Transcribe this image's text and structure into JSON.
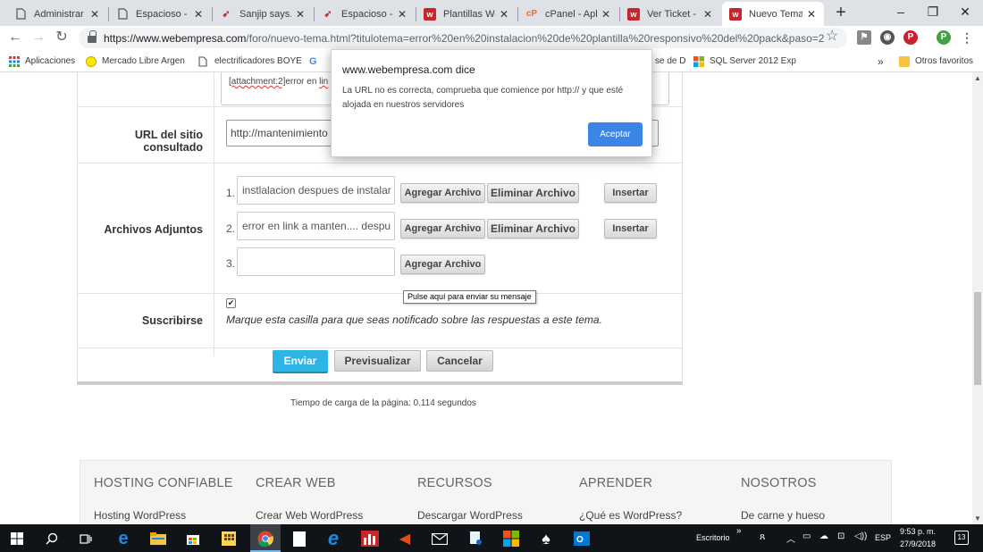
{
  "browser": {
    "tabs": [
      {
        "title": "Administrar te",
        "icon": "document-icon"
      },
      {
        "title": "Espacioso - Sir",
        "icon": "document-icon"
      },
      {
        "title": "Sanjip says...",
        "icon": "bird-icon"
      },
      {
        "title": "Espacioso - Re",
        "icon": "bird-icon"
      },
      {
        "title": "Plantillas Word",
        "icon": "webempresa-icon"
      },
      {
        "title": "cPanel - Aplica",
        "icon": "cpanel-icon"
      },
      {
        "title": "Ver Ticket - we",
        "icon": "webempresa-icon"
      },
      {
        "title": "Nuevo Tema",
        "icon": "webempresa-icon"
      }
    ],
    "new_tab": "+",
    "window_controls": {
      "minimize": "–",
      "restore": "❐",
      "close": "✕"
    },
    "url_host": "https://www.webempresa.com",
    "url_rest": "/foro/nuevo-tema.html?titulotema=error%20en%20instalacion%20de%20plantilla%20responsivo%20del%20pack&paso=2",
    "profile_initial": "P",
    "bookmarks": [
      {
        "label": "Aplicaciones"
      },
      {
        "label": "Mercado Libre Argen"
      },
      {
        "label": "electrificadores BOYE"
      },
      {
        "label": "G"
      },
      {
        "label": "se de D"
      },
      {
        "label": "SQL Server 2012 Exp"
      }
    ],
    "bookmarks_more": "»",
    "other_bookmarks": "Otros favoritos"
  },
  "form": {
    "textarea_attach": "[attachment:2]",
    "textarea_rest": "error en ",
    "textarea_link": "lin",
    "url_label": "URL del sitio consultado",
    "url_value": "http://mantenimiento",
    "attachments_label": "Archivos Adjuntos",
    "attachments": [
      {
        "num": "1.",
        "value": "instlalacion despues de instalar"
      },
      {
        "num": "2.",
        "value": "error en link a manten.... despu"
      },
      {
        "num": "3.",
        "value": ""
      }
    ],
    "add_file": "Agregar Archivo",
    "remove_file": "Eliminar Archivo",
    "insert": "Insertar",
    "tooltip": "Pulse aquí para enviar su mensaje",
    "subscribe_label": "Suscribirse",
    "checkbox_mark": "✔",
    "subscribe_text": "Marque esta casilla para que seas notificado sobre las respuestas a este tema.",
    "send": "Enviar",
    "preview": "Previsualizar",
    "cancel": "Cancelar",
    "load_time": "Tiempo de carga de la página: 0.114 segundos"
  },
  "footer": {
    "columns": [
      {
        "heading": "HOSTING CONFIABLE",
        "link": "Hosting WordPress"
      },
      {
        "heading": "CREAR WEB",
        "link": "Crear Web WordPress"
      },
      {
        "heading": "RECURSOS",
        "link": "Descargar WordPress"
      },
      {
        "heading": "APRENDER",
        "link": "¿Qué es WordPress?"
      },
      {
        "heading": "NOSOTROS",
        "link": "De carne y hueso"
      }
    ]
  },
  "dialog": {
    "title": "www.webempresa.com dice",
    "message": "La URL no es correcta, comprueba que comience por http:// y que esté alojada en nuestros servidores",
    "ok": "Aceptar"
  },
  "taskbar": {
    "desktop_label": "Escritorio",
    "chevron": "»",
    "language": "ESP",
    "time": "9:53 p. m.",
    "date": "27/9/2018",
    "notifications": "13"
  },
  "colors": {
    "accent_blue": "#2fb5e5",
    "dialog_button": "#3a85e6",
    "webempresa_red": "#c9252c"
  }
}
